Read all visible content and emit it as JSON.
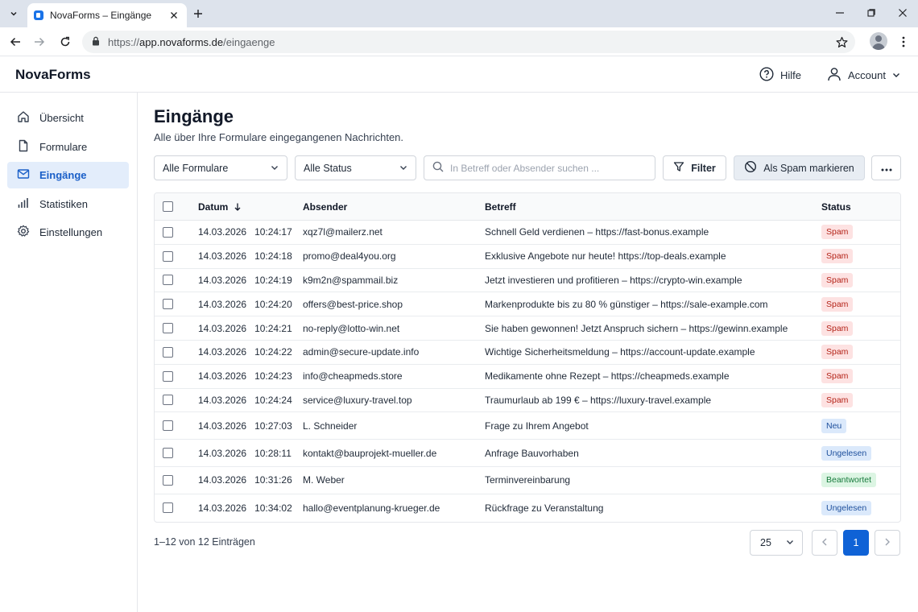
{
  "browser": {
    "tab_title": "NovaForms – Eingänge",
    "url_prefix": "https://",
    "url_host": "app.novaforms.de",
    "url_path": "/eingaenge"
  },
  "app": {
    "brand": "NovaForms",
    "help_label": "Hilfe",
    "account_label": "Account"
  },
  "sidebar": {
    "items": [
      {
        "label": "Übersicht",
        "icon": "home-icon"
      },
      {
        "label": "Formulare",
        "icon": "document-icon"
      },
      {
        "label": "Eingänge",
        "icon": "mail-icon",
        "active": true
      },
      {
        "label": "Statistiken",
        "icon": "bar-chart-icon"
      },
      {
        "label": "Einstellungen",
        "icon": "gear-icon"
      }
    ]
  },
  "main": {
    "title": "Eingänge",
    "subtitle": "Alle über Ihre Formulare eingegangenen Nachrichten.",
    "forms_filter": "Alle Formulare",
    "status_filter": "Alle Status",
    "search_placeholder": "In Betreff oder Absender suchen ...",
    "filter_label": "Filter",
    "spam_label": "Als Spam markieren"
  },
  "table": {
    "headers": {
      "date": "Datum",
      "sender": "Absender",
      "subject": "Betreff",
      "status": "Status"
    },
    "rows": [
      {
        "date": "14.03.2026",
        "time": "10:24:17",
        "sender": "xqz7l@mailerz.net",
        "subject": "Schnell Geld verdienen – https://fast-bonus.example",
        "status": "Spam",
        "kind": "spam"
      },
      {
        "date": "14.03.2026",
        "time": "10:24:18",
        "sender": "promo@deal4you.org",
        "subject": "Exklusive Angebote nur heute! https://top-deals.example",
        "status": "Spam",
        "kind": "spam"
      },
      {
        "date": "14.03.2026",
        "time": "10:24:19",
        "sender": "k9m2n@spammail.biz",
        "subject": "Jetzt investieren und profitieren – https://crypto-win.example",
        "status": "Spam",
        "kind": "spam"
      },
      {
        "date": "14.03.2026",
        "time": "10:24:20",
        "sender": "offers@best-price.shop",
        "subject": "Markenprodukte bis zu 80 % günstiger – https://sale-example.com",
        "status": "Spam",
        "kind": "spam"
      },
      {
        "date": "14.03.2026",
        "time": "10:24:21",
        "sender": "no-reply@lotto-win.net",
        "subject": "Sie haben gewonnen! Jetzt Anspruch sichern – https://gewinn.example",
        "status": "Spam",
        "kind": "spam"
      },
      {
        "date": "14.03.2026",
        "time": "10:24:22",
        "sender": "admin@secure-update.info",
        "subject": "Wichtige Sicherheitsmeldung – https://account-update.example",
        "status": "Spam",
        "kind": "spam"
      },
      {
        "date": "14.03.2026",
        "time": "10:24:23",
        "sender": "info@cheapmeds.store",
        "subject": "Medikamente ohne Rezept – https://cheapmeds.example",
        "status": "Spam",
        "kind": "spam"
      },
      {
        "date": "14.03.2026",
        "time": "10:24:24",
        "sender": "service@luxury-travel.top",
        "subject": "Traumurlaub ab 199 € – https://luxury-travel.example",
        "status": "Spam",
        "kind": "spam"
      },
      {
        "date": "14.03.2026",
        "time": "10:27:03",
        "sender": "L. Schneider",
        "subject": "Frage zu Ihrem Angebot",
        "status": "Neu",
        "kind": "neu"
      },
      {
        "date": "14.03.2026",
        "time": "10:28:11",
        "sender": "kontakt@bauprojekt-mueller.de",
        "subject": "Anfrage Bauvorhaben",
        "status": "Ungelesen",
        "kind": "ungelesen"
      },
      {
        "date": "14.03.2026",
        "time": "10:31:26",
        "sender": "M. Weber",
        "subject": "Terminvereinbarung",
        "status": "Beantwortet",
        "kind": "beantwortet"
      },
      {
        "date": "14.03.2026",
        "time": "10:34:02",
        "sender": "hallo@eventplanung-krueger.de",
        "subject": "Rückfrage zu Veranstaltung",
        "status": "Ungelesen",
        "kind": "ungelesen"
      }
    ]
  },
  "footer": {
    "count_text": "1–12 von 12 Einträgen",
    "page_size": "25",
    "current_page": "1"
  },
  "colors": {
    "accent": "#0f62d6",
    "active_nav_bg": "#e3edfb",
    "spam_bg": "#fde2e2",
    "spam_fg": "#b42318",
    "info_bg": "#dbe9fb",
    "success_bg": "#dcf5e3"
  }
}
